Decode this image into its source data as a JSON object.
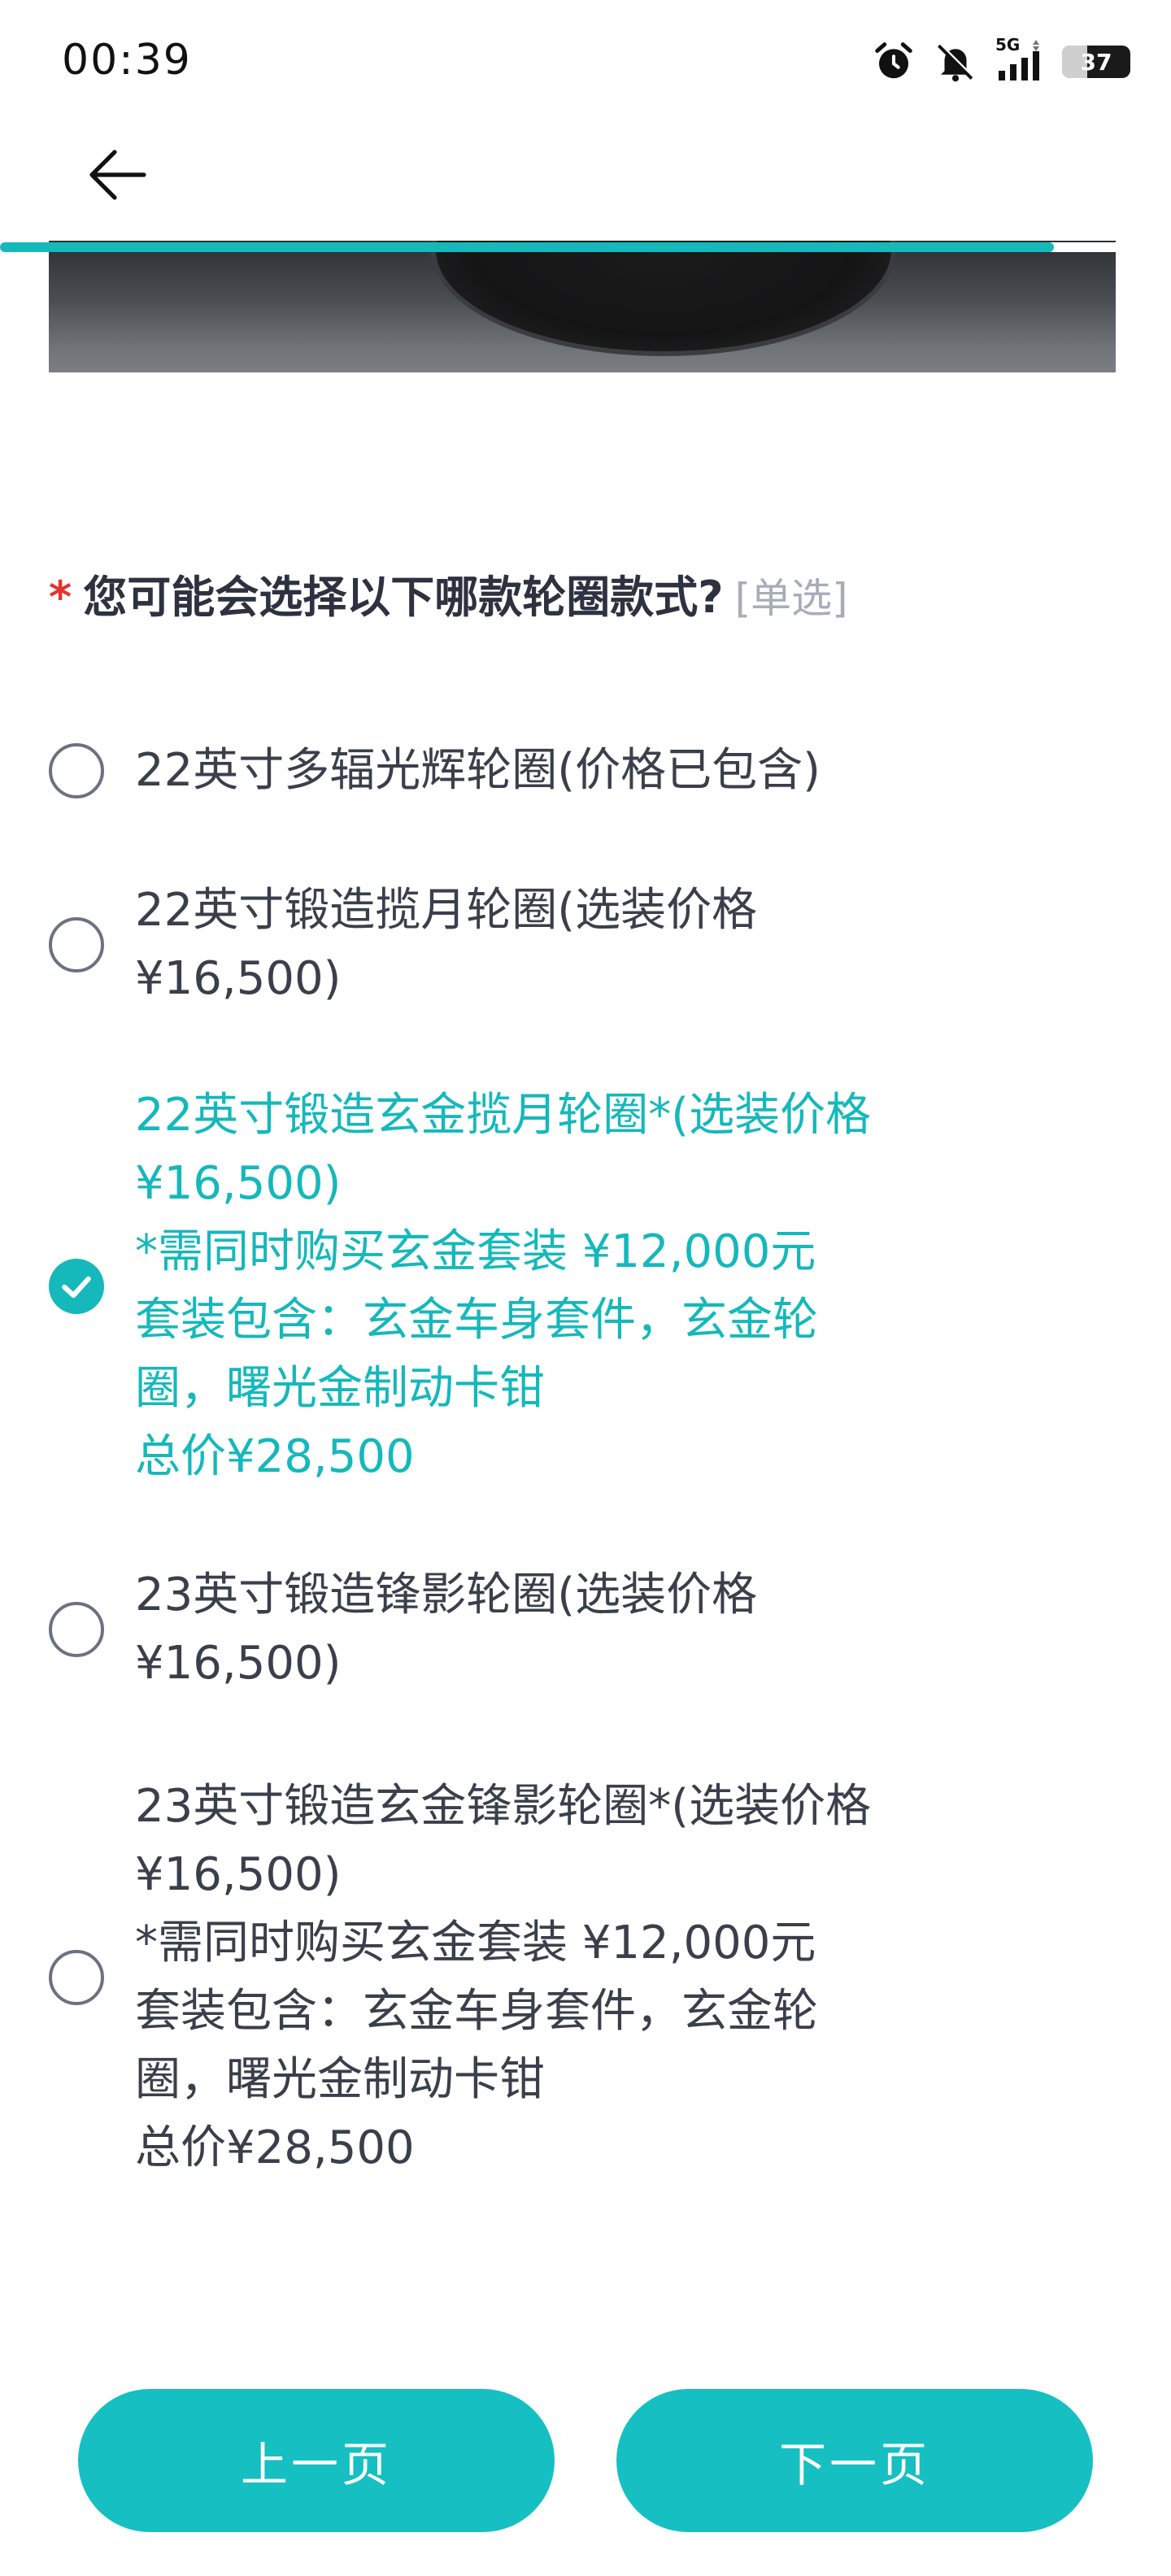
{
  "status_bar": {
    "time": "00:39",
    "network": "5G",
    "battery": "37",
    "battery_level": 0.37,
    "icons": [
      "alarm-icon",
      "mute-icon",
      "signal-icon",
      "battery-icon"
    ]
  },
  "header": {
    "back_icon": "back-arrow-icon",
    "progress": 0.9
  },
  "colors": {
    "accent": "#15b8bb",
    "required": "#e3342f",
    "text": "#3a3f4b"
  },
  "question": {
    "required_mark": "*",
    "title": "您可能会选择以下哪款轮圈款式?",
    "type_tag": "[单选]"
  },
  "options": [
    {
      "text": "22英寸多辐光辉轮圈(价格已包含)",
      "selected": false
    },
    {
      "text": "22英寸锻造揽月轮圈(选装价格\n¥16,500)",
      "selected": false
    },
    {
      "text": "22英寸锻造玄金揽月轮圈*(选装价格\n¥16,500)\n*需同时购买玄金套装 ¥12,000元\n套装包含：玄金车身套件，玄金轮\n圈，曙光金制动卡钳\n总价¥28,500",
      "selected": true
    },
    {
      "text": "23英寸锻造锋影轮圈(选装价格\n¥16,500)",
      "selected": false
    },
    {
      "text": "23英寸锻造玄金锋影轮圈*(选装价格\n¥16,500)\n*需同时购买玄金套装 ¥12,000元\n套装包含：玄金车身套件，玄金轮\n圈，曙光金制动卡钳\n总价¥28,500",
      "selected": false
    }
  ],
  "footer": {
    "prev_label": "上一页",
    "next_label": "下一页"
  }
}
